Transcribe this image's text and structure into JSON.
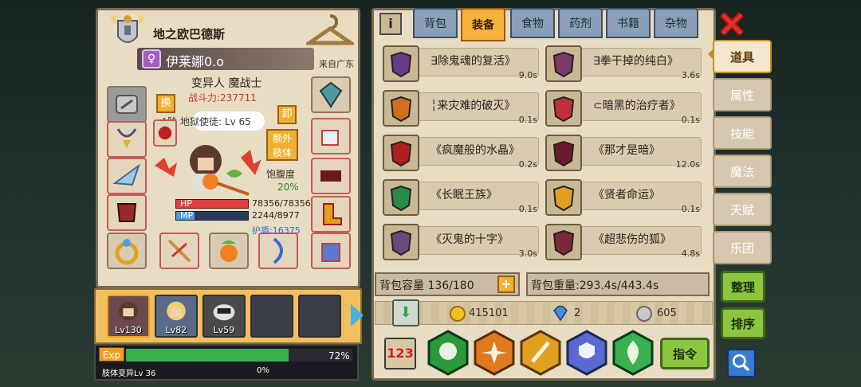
{
  "left": {
    "title": "地之欧巴德斯",
    "char_name": "伊莱娜0.o",
    "origin": "来自广东",
    "class": "变异人 魔战士",
    "power": "战斗力:237711",
    "swap_btn": "换",
    "unload_btn": "卸",
    "extra_limb_btn": "额外\n肢体",
    "rank": "A阶 地狱使徒: Lv 65",
    "satiety_label": "饱腹度",
    "satiety_value": "20%",
    "hp_label": "HP",
    "hp_value": "78356/78356",
    "mp_label": "MP",
    "mp_value": "2244/8977",
    "shield": "护盾:16375",
    "exp_label": "Exp",
    "exp_pct": "72%",
    "exp_fill": 0.72,
    "limb_label": "肢体变异Lv 36",
    "limb_pct": "0%",
    "party": [
      {
        "lv": "Lv130"
      },
      {
        "lv": "Lv82"
      },
      {
        "lv": "Lv59"
      }
    ]
  },
  "tabs": [
    "背包",
    "装备",
    "食物",
    "药剂",
    "书籍",
    "杂物"
  ],
  "active_tab": "装备",
  "items": [
    {
      "name": "∃除鬼魂的复活》",
      "time": "9.0s",
      "color": "#6a3a8a"
    },
    {
      "name": "∃拳干掉的纯白》",
      "time": "3.6s",
      "color": "#7a3a6a"
    },
    {
      "name": "╎来灾难的破灭》",
      "time": "0.1s",
      "color": "#d07020"
    },
    {
      "name": "⊂暗黑的治疗者》",
      "time": "0.1s",
      "color": "#c0303a"
    },
    {
      "name": "《疯魔般的水晶》",
      "time": "0.2s",
      "color": "#b02020"
    },
    {
      "name": "《那才是暗》",
      "time": "12.0s",
      "color": "#6a1a2a"
    },
    {
      "name": "《长眠王族》",
      "time": "0.1s",
      "color": "#2a8a4a"
    },
    {
      "name": "《贤者命运》",
      "time": "0.1s",
      "color": "#e0a020"
    },
    {
      "name": "《灭鬼的十字》",
      "time": "3.0s",
      "color": "#6a4a7a"
    },
    {
      "name": "《超悲伤的狐》",
      "time": "4.8s",
      "color": "#7a2a3a"
    }
  ],
  "capacity": "背包容量 136/180",
  "weight": "背包重量:293.4s/443.4s",
  "gold": "415101",
  "gems": "2",
  "silver": "605",
  "command_btn": "指令",
  "side_tabs": [
    "道具",
    "属性",
    "技能",
    "魔法",
    "天赋",
    "乐团"
  ],
  "organize_btn": "整理",
  "sort_btn": "排序",
  "info_icon": "i",
  "colors": {
    "accent": "#f6b23a",
    "green": "#8cc640",
    "hp": "#e04040",
    "mp": "#4a9ae0"
  }
}
